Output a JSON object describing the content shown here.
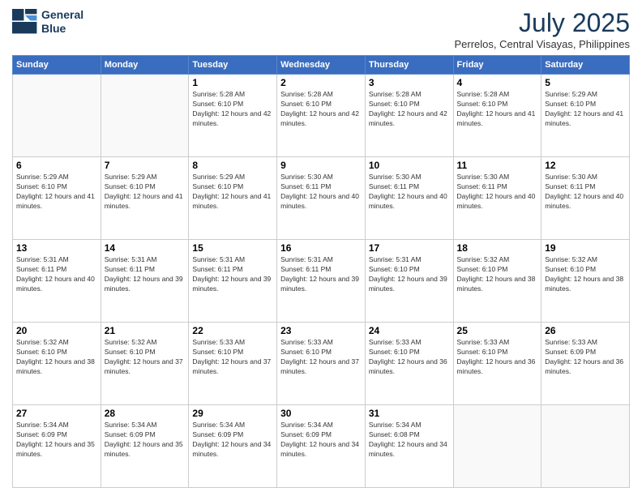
{
  "logo": {
    "line1": "General",
    "line2": "Blue"
  },
  "title": "July 2025",
  "location": "Perrelos, Central Visayas, Philippines",
  "days_of_week": [
    "Sunday",
    "Monday",
    "Tuesday",
    "Wednesday",
    "Thursday",
    "Friday",
    "Saturday"
  ],
  "weeks": [
    [
      {
        "day": "",
        "info": ""
      },
      {
        "day": "",
        "info": ""
      },
      {
        "day": "1",
        "info": "Sunrise: 5:28 AM\nSunset: 6:10 PM\nDaylight: 12 hours and 42 minutes."
      },
      {
        "day": "2",
        "info": "Sunrise: 5:28 AM\nSunset: 6:10 PM\nDaylight: 12 hours and 42 minutes."
      },
      {
        "day": "3",
        "info": "Sunrise: 5:28 AM\nSunset: 6:10 PM\nDaylight: 12 hours and 42 minutes."
      },
      {
        "day": "4",
        "info": "Sunrise: 5:28 AM\nSunset: 6:10 PM\nDaylight: 12 hours and 41 minutes."
      },
      {
        "day": "5",
        "info": "Sunrise: 5:29 AM\nSunset: 6:10 PM\nDaylight: 12 hours and 41 minutes."
      }
    ],
    [
      {
        "day": "6",
        "info": "Sunrise: 5:29 AM\nSunset: 6:10 PM\nDaylight: 12 hours and 41 minutes."
      },
      {
        "day": "7",
        "info": "Sunrise: 5:29 AM\nSunset: 6:10 PM\nDaylight: 12 hours and 41 minutes."
      },
      {
        "day": "8",
        "info": "Sunrise: 5:29 AM\nSunset: 6:10 PM\nDaylight: 12 hours and 41 minutes."
      },
      {
        "day": "9",
        "info": "Sunrise: 5:30 AM\nSunset: 6:11 PM\nDaylight: 12 hours and 40 minutes."
      },
      {
        "day": "10",
        "info": "Sunrise: 5:30 AM\nSunset: 6:11 PM\nDaylight: 12 hours and 40 minutes."
      },
      {
        "day": "11",
        "info": "Sunrise: 5:30 AM\nSunset: 6:11 PM\nDaylight: 12 hours and 40 minutes."
      },
      {
        "day": "12",
        "info": "Sunrise: 5:30 AM\nSunset: 6:11 PM\nDaylight: 12 hours and 40 minutes."
      }
    ],
    [
      {
        "day": "13",
        "info": "Sunrise: 5:31 AM\nSunset: 6:11 PM\nDaylight: 12 hours and 40 minutes."
      },
      {
        "day": "14",
        "info": "Sunrise: 5:31 AM\nSunset: 6:11 PM\nDaylight: 12 hours and 39 minutes."
      },
      {
        "day": "15",
        "info": "Sunrise: 5:31 AM\nSunset: 6:11 PM\nDaylight: 12 hours and 39 minutes."
      },
      {
        "day": "16",
        "info": "Sunrise: 5:31 AM\nSunset: 6:11 PM\nDaylight: 12 hours and 39 minutes."
      },
      {
        "day": "17",
        "info": "Sunrise: 5:31 AM\nSunset: 6:10 PM\nDaylight: 12 hours and 39 minutes."
      },
      {
        "day": "18",
        "info": "Sunrise: 5:32 AM\nSunset: 6:10 PM\nDaylight: 12 hours and 38 minutes."
      },
      {
        "day": "19",
        "info": "Sunrise: 5:32 AM\nSunset: 6:10 PM\nDaylight: 12 hours and 38 minutes."
      }
    ],
    [
      {
        "day": "20",
        "info": "Sunrise: 5:32 AM\nSunset: 6:10 PM\nDaylight: 12 hours and 38 minutes."
      },
      {
        "day": "21",
        "info": "Sunrise: 5:32 AM\nSunset: 6:10 PM\nDaylight: 12 hours and 37 minutes."
      },
      {
        "day": "22",
        "info": "Sunrise: 5:33 AM\nSunset: 6:10 PM\nDaylight: 12 hours and 37 minutes."
      },
      {
        "day": "23",
        "info": "Sunrise: 5:33 AM\nSunset: 6:10 PM\nDaylight: 12 hours and 37 minutes."
      },
      {
        "day": "24",
        "info": "Sunrise: 5:33 AM\nSunset: 6:10 PM\nDaylight: 12 hours and 36 minutes."
      },
      {
        "day": "25",
        "info": "Sunrise: 5:33 AM\nSunset: 6:10 PM\nDaylight: 12 hours and 36 minutes."
      },
      {
        "day": "26",
        "info": "Sunrise: 5:33 AM\nSunset: 6:09 PM\nDaylight: 12 hours and 36 minutes."
      }
    ],
    [
      {
        "day": "27",
        "info": "Sunrise: 5:34 AM\nSunset: 6:09 PM\nDaylight: 12 hours and 35 minutes."
      },
      {
        "day": "28",
        "info": "Sunrise: 5:34 AM\nSunset: 6:09 PM\nDaylight: 12 hours and 35 minutes."
      },
      {
        "day": "29",
        "info": "Sunrise: 5:34 AM\nSunset: 6:09 PM\nDaylight: 12 hours and 34 minutes."
      },
      {
        "day": "30",
        "info": "Sunrise: 5:34 AM\nSunset: 6:09 PM\nDaylight: 12 hours and 34 minutes."
      },
      {
        "day": "31",
        "info": "Sunrise: 5:34 AM\nSunset: 6:08 PM\nDaylight: 12 hours and 34 minutes."
      },
      {
        "day": "",
        "info": ""
      },
      {
        "day": "",
        "info": ""
      }
    ]
  ]
}
